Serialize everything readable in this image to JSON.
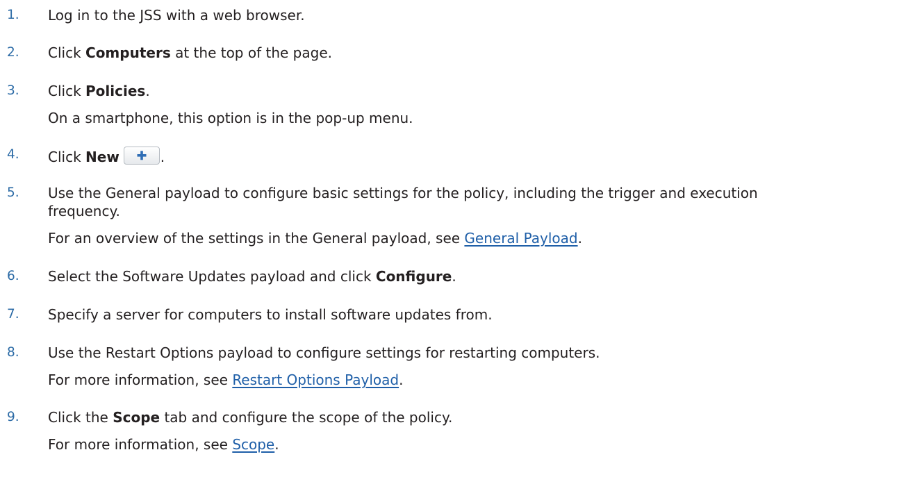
{
  "steps": [
    {
      "num": "1.",
      "text": "Log in to the JSS with a web browser."
    },
    {
      "num": "2.",
      "pre": "Click ",
      "bold": "Computers",
      "post": " at the top of the page."
    },
    {
      "num": "3.",
      "pre": "Click ",
      "bold": "Policies",
      "post": ".",
      "note": "On a smartphone, this option is in the pop-up menu."
    },
    {
      "num": "4.",
      "pre": "Click ",
      "bold": "New",
      "post": ".",
      "icon": "plus-icon"
    },
    {
      "num": "5.",
      "line1": "Use the General payload to configure basic settings for the policy, including the trigger and execution",
      "line2": "frequency.",
      "note_pre": "For an overview of the settings in the General payload, see ",
      "note_link": "General Payload",
      "note_post": "."
    },
    {
      "num": "6.",
      "pre": "Select the Software Updates payload and click ",
      "bold": "Configure",
      "post": "."
    },
    {
      "num": "7.",
      "text": "Specify a server for computers to install software updates from."
    },
    {
      "num": "8.",
      "text": "Use the Restart Options payload to configure settings for restarting computers.",
      "note_pre": "For more information, see ",
      "note_link": "Restart Options Payload",
      "note_post": "."
    },
    {
      "num": "9.",
      "pre": "Click the ",
      "bold": "Scope",
      "post": " tab and configure the scope of the policy.",
      "note_pre": "For more information, see ",
      "note_link": "Scope",
      "note_post": "."
    }
  ],
  "colors": {
    "number": "#2c6ba6",
    "link": "#1f5fa8",
    "text": "#231f20",
    "plus_icon": "#2f6db5"
  }
}
